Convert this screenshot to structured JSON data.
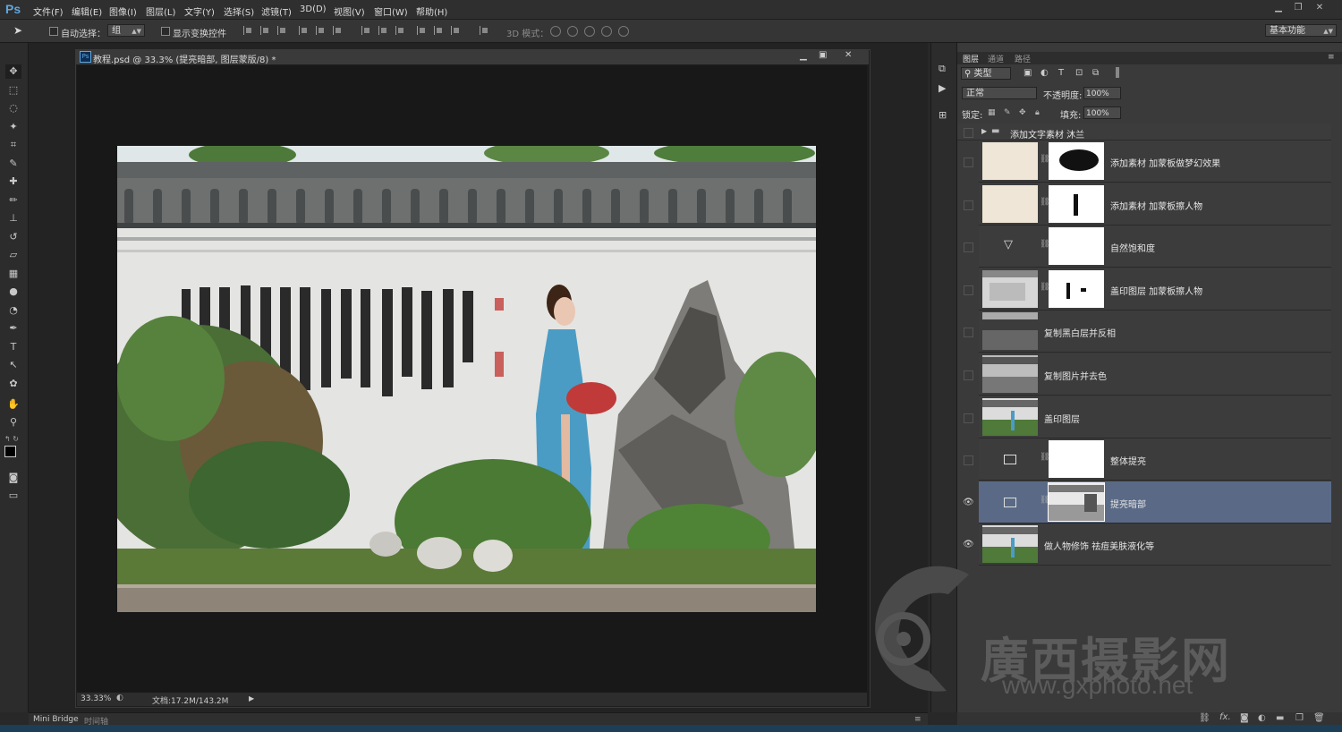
{
  "app": {
    "logo": "Ps",
    "menu": [
      "文件(F)",
      "编辑(E)",
      "图像(I)",
      "图层(L)",
      "文字(Y)",
      "选择(S)",
      "滤镜(T)",
      "3D(D)",
      "视图(V)",
      "窗口(W)",
      "帮助(H)"
    ]
  },
  "options": {
    "auto_select_label": "自动选择：",
    "auto_select_value": "组",
    "transform_label": "显示变换控件",
    "mode3d_label": "3D 模式：",
    "workspace": "基本功能"
  },
  "document": {
    "tab_icon": "Ps",
    "title": "教程.psd @ 33.3% (提亮暗部, 图层蒙版/8) *",
    "zoom": "33.33%",
    "doc_size": "文档:17.2M/143.2M"
  },
  "bottom_tabs": [
    "Mini Bridge",
    "时间轴"
  ],
  "layers_panel": {
    "tabs": [
      "图层",
      "通道",
      "路径"
    ],
    "filter_label": "类型",
    "blend_mode": "正常",
    "opacity_label": "不透明度:",
    "opacity_value": "100%",
    "lock_label": "锁定:",
    "fill_label": "填充:",
    "fill_value": "100%",
    "group": {
      "name": "添加文字素材  沐兰"
    },
    "layers": [
      {
        "name": "添加素材  加蒙板做梦幻效果",
        "visible": false
      },
      {
        "name": "添加素材  加蒙板擦人物",
        "visible": false
      },
      {
        "name": "自然饱和度",
        "visible": false
      },
      {
        "name": "盖印图层  加蒙板擦人物",
        "visible": false
      },
      {
        "name": "复制黑白层并反相",
        "visible": false
      },
      {
        "name": "复制图片并去色",
        "visible": false
      },
      {
        "name": "盖印图层",
        "visible": false
      },
      {
        "name": "整体提亮",
        "visible": false
      },
      {
        "name": "提亮暗部",
        "visible": true,
        "selected": true
      },
      {
        "name": "做人物修饰  祛痘美肤液化等",
        "visible": true
      }
    ]
  },
  "watermark": {
    "text": "廣西摄影网",
    "url": "www.gxphoto.net"
  }
}
